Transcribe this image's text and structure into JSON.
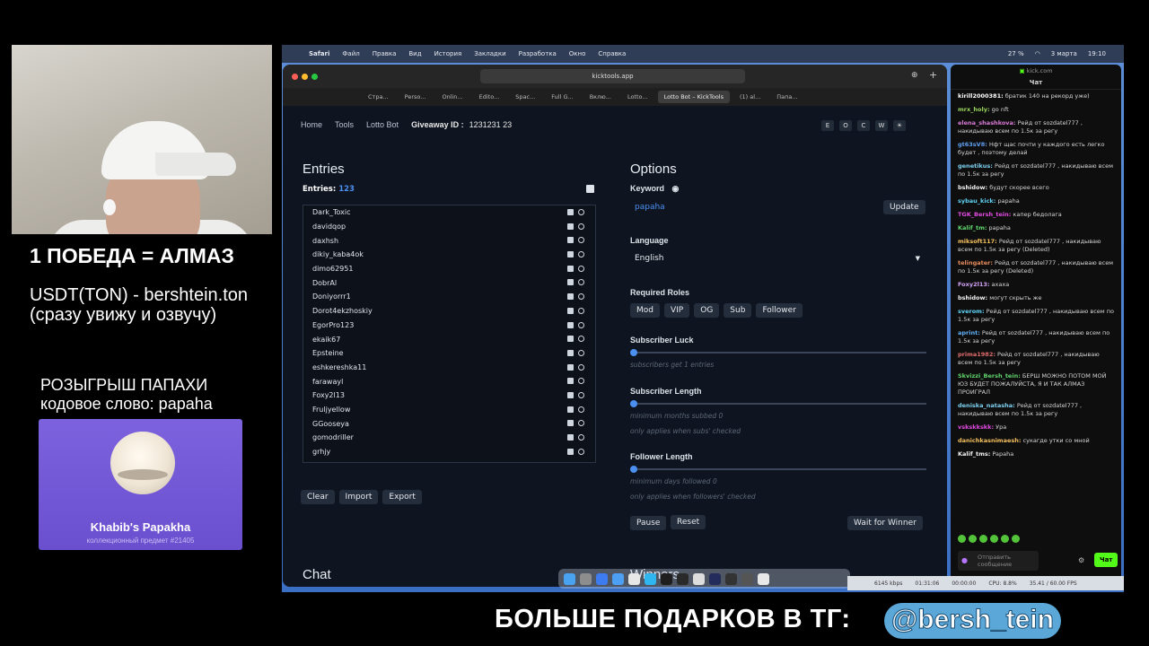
{
  "overlay": {
    "win_title": "1 ПОБЕДА = АЛМАЗ",
    "usdt_line1": "USDT(TON) - bershtein.ton",
    "usdt_line2": "(сразу увижу и озвучу)",
    "giveaway_line1": "РОЗЫГРЫШ ПАПАХИ",
    "giveaway_line2": "кодовое слово: papaha",
    "nft_name": "Khabib's Papakha",
    "nft_sub": "коллекционный предмет #21405",
    "banner_text": "БОЛЬШЕ ПОДАРКОВ В ТГ:",
    "banner_handle": "@bersh_tein"
  },
  "menubar": {
    "items": [
      "Safari",
      "Файл",
      "Правка",
      "Вид",
      "История",
      "Закладки",
      "Разработка",
      "Окно",
      "Справка"
    ],
    "battery": "27 %",
    "date": "3 марта",
    "time": "19:10"
  },
  "browser": {
    "url": "kicktools.app",
    "tabs": [
      "Стра...",
      "Perso...",
      "Onlin...",
      "Edito...",
      "Spac...",
      "Full G...",
      "Вклю...",
      "Lotto...",
      "Lotto Bot – KickTools",
      "(1) al...",
      "Папа..."
    ],
    "active_tab": "Lotto Bot – KickTools"
  },
  "nav": {
    "home": "Home",
    "tools": "Tools",
    "lotto": "Lotto Bot",
    "giveaway_label": "Giveaway ID :",
    "giveaway_id": "1231231 23",
    "btns": [
      "E",
      "O",
      "C",
      "W",
      "☀"
    ]
  },
  "entries": {
    "title": "Entries",
    "count_label": "Entries:",
    "count": "123",
    "list": [
      "Dark_Toxic",
      "davidqop",
      "daxhsh",
      "dikiy_kaba4ok",
      "dimo62951",
      "DobrAl",
      "Doniyorrr1",
      "Dorot4ekzhoskiy",
      "EgorPro123",
      "ekaik67",
      "Epsteine",
      "eshkereshka11",
      "farawayl",
      "Foxy2l13",
      "Fruljyellow",
      "GGooseya",
      "gomodriller",
      "grhjy"
    ],
    "clear": "Clear",
    "import": "Import",
    "export": "Export"
  },
  "options": {
    "title": "Options",
    "keyword_label": "Keyword",
    "keyword_value": "papaha",
    "update": "Update",
    "language_label": "Language",
    "language_value": "English",
    "roles_label": "Required Roles",
    "roles": [
      "Mod",
      "VIP",
      "OG",
      "Sub",
      "Follower"
    ],
    "sub_luck_label": "Subscriber Luck",
    "sub_luck_hint": "subscribers get 1 entries",
    "sub_luck_value": 0,
    "sub_len_label": "Subscriber Length",
    "sub_len_hint1": "minimum months subbed 0",
    "sub_len_hint2": "only applies when subs' checked",
    "sub_len_value": 0,
    "fol_len_label": "Follower Length",
    "fol_len_hint1": "minimum days followed 0",
    "fol_len_hint2": "only applies when followers' checked",
    "fol_len_value": 0,
    "pause": "Pause",
    "reset": "Reset",
    "wait": "Wait for Winner"
  },
  "sections": {
    "chat": "Chat",
    "winners": "Winners"
  },
  "kickchat": {
    "site": "kick.com",
    "title": "Чат",
    "messages": [
      {
        "user": "kirill2000381:",
        "text": "братик 140 на рекорд уже)",
        "color": "#ffffff"
      },
      {
        "user": "mrx_holy:",
        "text": "go nft",
        "color": "#9ad45c"
      },
      {
        "user": "elena_shashkova:",
        "text": "Рейд от sozdatel777 , накидываю всем по 1.5к за регу",
        "color": "#d77ad6"
      },
      {
        "user": "gt63sV8:",
        "text": "Нфт щас почти у каждого есть легко будет , поэтому делай",
        "color": "#5f9ff2"
      },
      {
        "user": "genetikus:",
        "text": "Рейд от sozdatel777 , накидываю всем по 1.5к за регу",
        "color": "#7dd0f0"
      },
      {
        "user": "bshidow:",
        "text": "будут скорее всего",
        "color": "#f2f2f2"
      },
      {
        "user": "sybau_kick:",
        "text": "papaha",
        "color": "#5fd3f5"
      },
      {
        "user": "TGK_Bersh_tein:",
        "text": "капер бедолага",
        "color": "#e14be0"
      },
      {
        "user": "Kalif_tm:",
        "text": "papaha",
        "color": "#5fd36c"
      },
      {
        "user": "miksoft117:",
        "text": "Рейд от sozdatel777 , накидываю всем по 1.5к за регу (Deleted)",
        "color": "#f4c05e"
      },
      {
        "user": "telingater:",
        "text": "Рейд от sozdatel777 , накидываю всем по 1.5к за регу (Deleted)",
        "color": "#e88c5d"
      },
      {
        "user": "Foxy2l13:",
        "text": "ахаха",
        "color": "#d2a1f5"
      },
      {
        "user": "bshidow:",
        "text": "могут скрыть же",
        "color": "#f2f2f2"
      },
      {
        "user": "sverom:",
        "text": "Рейд от sozdatel777 , накидываю всем по 1.5к за регу",
        "color": "#5fd3f5"
      },
      {
        "user": "aprint:",
        "text": "Рейд от sozdatel777 , накидываю всем по 1.5к за регу",
        "color": "#5fb0f5"
      },
      {
        "user": "prima1982:",
        "text": "Рейд от sozdatel777 , накидываю всем по 1.5к за регу",
        "color": "#e06c6c"
      },
      {
        "user": "Skvizzi_Bersh_tein:",
        "text": "БЕРШ МОЖНО ПОТОМ МОЙ ЮЗ БУДЕТ ПОЖАЛУЙСТА, Я И ТАК АЛМАЗ ПРОИГРАЛ",
        "color": "#5fd36c"
      },
      {
        "user": "deniska_natasha:",
        "text": "Рейд от sozdatel777 , накидываю всем по 1.5к за регу",
        "color": "#7dd0f0"
      },
      {
        "user": "vskskkskk:",
        "text": "Ура",
        "color": "#e14be0"
      },
      {
        "user": "danichkasnimaesh:",
        "text": "сукагде утки со мной",
        "color": "#f4c05e"
      },
      {
        "user": "Kalif_tms:",
        "text": "Papaha",
        "color": "#f2f2f2"
      }
    ],
    "input_placeholder": "Отправить сообщение",
    "send": "Чат"
  },
  "obs": {
    "kbps": "6145 kbps",
    "time1": "01:31:06",
    "time2": "00:00:00",
    "cpu": "CPU: 8.8%",
    "fps": "35.41 / 60.00 FPS"
  },
  "colors": {
    "accent": "#4b8ff0",
    "kick_green": "#53fc18"
  }
}
